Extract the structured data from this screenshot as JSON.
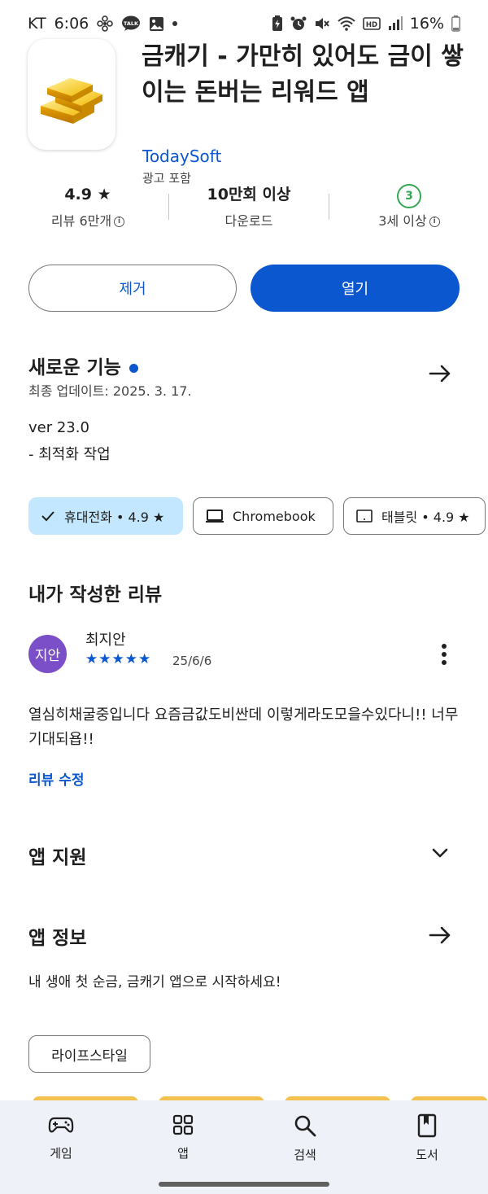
{
  "status_bar": {
    "carrier": "KT",
    "time": "6:06",
    "talk_badge": "TALK",
    "hd_badge": "HD",
    "battery": "16%"
  },
  "app": {
    "title": "금캐기 - 가만히 있어도 금이 쌓이는 돈버는 리워드 앱",
    "developer": "TodaySoft",
    "ad_notice": "광고 포함"
  },
  "stats": {
    "rating": "4.9",
    "reviews_label": "리뷰 6만개",
    "downloads": "10만회 이상",
    "downloads_label": "다운로드",
    "age_rating": "3",
    "age_label": "3세 이상"
  },
  "actions": {
    "remove_label": "제거",
    "open_label": "열기"
  },
  "whats_new": {
    "title": "새로운 기능",
    "updated": "최종 업데이트: 2025. 3. 17.",
    "version": "ver 23.0",
    "note": "- 최적화 작업"
  },
  "devices": {
    "phone_label": "휴대전화 • 4.9 ★",
    "chromebook_label": "Chromebook",
    "tablet_label": "태블릿 • 4.9 ★"
  },
  "my_review": {
    "section_title": "내가 작성한 리뷰",
    "avatar_text": "지안",
    "avatar_color": "#7b4fc7",
    "author": "최지안",
    "stars": "★★★★★",
    "rating": 5,
    "date": "25/6/6",
    "text": "열심히채굴중입니다 요즘금값도비싼데 이렇게라도모을수있다니!! 너무기대되욥!!",
    "edit_label": "리뷰 수정"
  },
  "app_support": {
    "title": "앱 지원"
  },
  "about": {
    "title": "앱 정보",
    "description": "내 생애 첫 순금, 금캐기 앱으로 시작하세요!",
    "tag": "라이프스타일"
  },
  "bottom_nav": {
    "items": [
      {
        "label": "게임",
        "icon": "gamepad-icon"
      },
      {
        "label": "앱",
        "icon": "apps-grid-icon"
      },
      {
        "label": "검색",
        "icon": "search-icon"
      },
      {
        "label": "도서",
        "icon": "book-icon"
      }
    ]
  },
  "colors": {
    "accent": "#0b57d0",
    "chip_selected": "#c2e7ff",
    "age_green": "#34a853",
    "nav_bg": "#eef1f7"
  }
}
